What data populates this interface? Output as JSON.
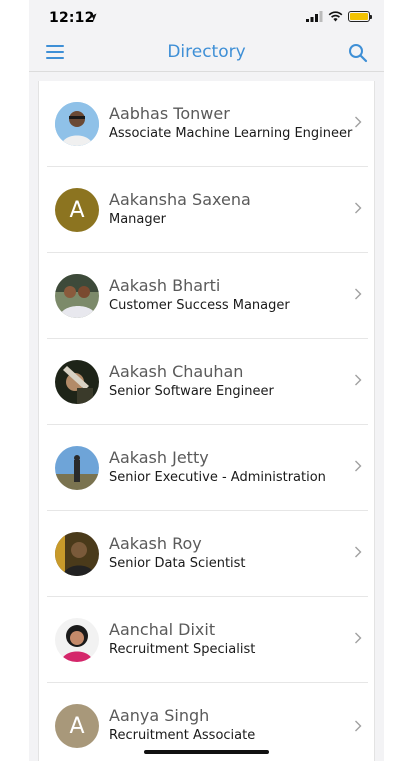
{
  "status_bar": {
    "time": "12:12"
  },
  "nav": {
    "title": "Directory"
  },
  "employees": [
    {
      "name": "Aabhas Tonwer",
      "title": "Associate Machine Learning Engineer",
      "avatar": "photo"
    },
    {
      "name": "Aakansha Saxena",
      "title": "Manager",
      "avatar": "letter",
      "initial": "A",
      "color": "#8c7420"
    },
    {
      "name": "Aakash Bharti",
      "title": "Customer Success Manager",
      "avatar": "photo"
    },
    {
      "name": "Aakash Chauhan",
      "title": "Senior Software Engineer",
      "avatar": "photo"
    },
    {
      "name": "Aakash Jetty",
      "title": "Senior Executive - Administration",
      "avatar": "photo"
    },
    {
      "name": "Aakash Roy",
      "title": "Senior Data Scientist",
      "avatar": "photo"
    },
    {
      "name": "Aanchal Dixit",
      "title": "Recruitment Specialist",
      "avatar": "photo"
    },
    {
      "name": "Aanya Singh",
      "title": "Recruitment Associate",
      "avatar": "letter",
      "initial": "A",
      "color": "#a8987a"
    }
  ],
  "colors": {
    "accent": "#3e8fd6"
  }
}
